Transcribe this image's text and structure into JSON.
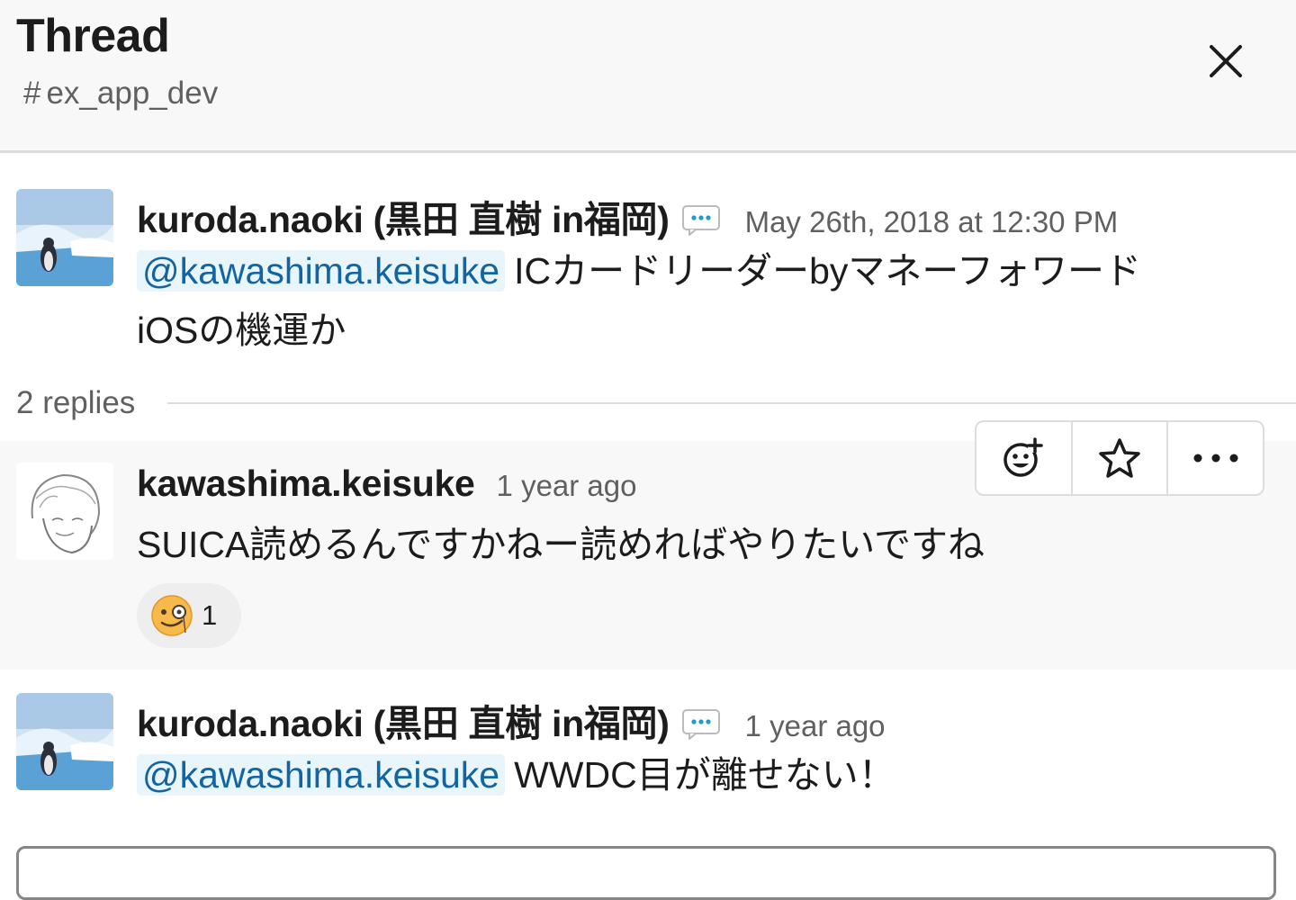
{
  "header": {
    "title": "Thread",
    "channel_hash": "#",
    "channel": "ex_app_dev"
  },
  "parent": {
    "author": "kuroda.naoki (黒田 直樹 in福岡)",
    "timestamp": "May 26th, 2018 at 12:30 PM",
    "mention": "@kawashima.keisuke",
    "text_line1": "ICカードリーダーbyマネーフォワード",
    "text_line2": "iOSの機運か"
  },
  "replies": {
    "label": "2 replies"
  },
  "reply1": {
    "author": "kawashima.keisuke",
    "timestamp": "1 year ago",
    "text": "SUICA読めるんですかねー読めればやりたいですね",
    "reaction_count": "1"
  },
  "reply2": {
    "author": "kuroda.naoki (黒田 直樹 in福岡)",
    "timestamp": "1 year ago",
    "mention": "@kawashima.keisuke",
    "text": "WWDC目が離せない！"
  },
  "icons": {
    "close": "close-icon",
    "chat": "chat-bubble-icon",
    "add_reaction": "add-reaction-icon",
    "star": "star-icon",
    "more": "more-actions-icon",
    "reaction_emoji": "monocle-face-icon"
  },
  "colors": {
    "mention_text": "#1264a3",
    "mention_bg": "#e8f5fa",
    "hover_bg": "#f8f8f8",
    "muted": "#616061"
  }
}
